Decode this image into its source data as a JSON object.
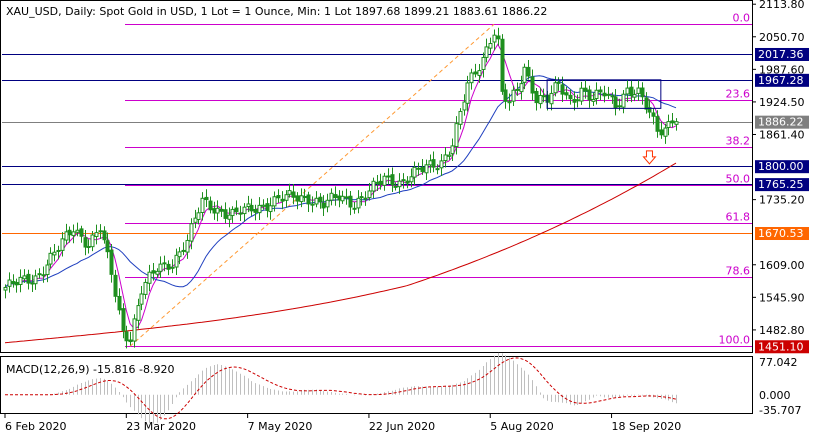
{
  "chart_data": {
    "type": "candlestick",
    "instrument": {
      "header": "XAU_USD, Daily:  Spot Gold in USD, 1 Lot = 1 Ounce, Min: 1 Lot  1897.68 1899.21 1883.61 1886.22"
    },
    "price_axis": {
      "ticks": [
        "2113.80",
        "2050.70",
        "1987.60",
        "1924.50",
        "1861.40",
        "1735.20",
        "1609.00",
        "1545.90",
        "1482.80"
      ],
      "ylim": [
        1440,
        2120
      ]
    },
    "date_axis": {
      "ticks": [
        "6 Feb 2020",
        "23 Mar 2020",
        "7 May 2020",
        "22 Jun 2020",
        "5 Aug 2020",
        "18 Sep 2020"
      ]
    },
    "horizontal_levels": [
      {
        "value": 2017.36,
        "label": "2017.36",
        "line_color": "#000080",
        "label_bg": "#000080",
        "label_fg": "#ffffff"
      },
      {
        "value": 1967.28,
        "label": "1967.28",
        "line_color": "#000080",
        "label_bg": "#000080",
        "label_fg": "#ffffff"
      },
      {
        "value": 1886.22,
        "label": "1886.22",
        "line_color": "#7f7f7f",
        "label_bg": "#7f7f7f",
        "label_fg": "#ffffff"
      },
      {
        "value": 1800.0,
        "label": "1800.00",
        "line_color": "#000080",
        "label_bg": "#000080",
        "label_fg": "#ffffff"
      },
      {
        "value": 1765.25,
        "label": "1765.25",
        "line_color": "#000080",
        "label_bg": "#000080",
        "label_fg": "#ffffff"
      },
      {
        "value": 1670.53,
        "label": "1670.53",
        "line_color": "#ff6600",
        "label_bg": "#ff6600",
        "label_fg": "#ffffff"
      },
      {
        "value": 1451.1,
        "label": "1451.10",
        "line_color": "#000000",
        "label_bg": "#cc0000",
        "label_fg": "#ffffff"
      }
    ],
    "fibonacci": {
      "color": "#cc00cc",
      "high": 2075,
      "low": 1451.1,
      "levels": [
        {
          "label": "0.0",
          "value": 2075.0
        },
        {
          "label": "23.6",
          "value": 1927.8
        },
        {
          "label": "38.2",
          "value": 1836.7
        },
        {
          "label": "50.0",
          "value": 1763.0
        },
        {
          "label": "61.8",
          "value": 1689.4
        },
        {
          "label": "78.6",
          "value": 1584.5
        },
        {
          "label": "100.0",
          "value": 1451.1
        }
      ]
    },
    "rectangle_zone": {
      "color": "#000080",
      "price_top": 1967.28,
      "price_bottom": 1912.0,
      "from_day": 143,
      "to_day": 173
    },
    "down_arrow": {
      "color": "#ff3300",
      "price": 1818,
      "day": 170
    },
    "moving_averages": [
      {
        "color": "#cc00cc",
        "period_note": "fast"
      },
      {
        "color": "#1f3fbf",
        "period_note": "medium"
      },
      {
        "color": "#cc0000",
        "period_note": "slow"
      }
    ],
    "macd": {
      "label": "MACD(12,26,9) -15.816 -8.920",
      "ticks": [
        "77.042",
        "0.000",
        "-35.707"
      ],
      "ylim": [
        -35.707,
        77.042
      ],
      "histogram_color": "#bfbfbf",
      "signal_color": "#cc0000"
    },
    "colors": {
      "bull_candle": "#1f8f1f",
      "bear_candle": "#1f8f1f",
      "background": "#ffffff",
      "axis": "#000000"
    },
    "series_days": {
      "start_label": "6 Feb 2020",
      "bars": 178
    },
    "anchors": [
      [
        0,
        1565
      ],
      [
        8,
        1585
      ],
      [
        14,
        1640
      ],
      [
        18,
        1680
      ],
      [
        22,
        1650
      ],
      [
        25,
        1680
      ],
      [
        28,
        1590
      ],
      [
        31,
        1480
      ],
      [
        33,
        1470
      ],
      [
        36,
        1560
      ],
      [
        40,
        1600
      ],
      [
        44,
        1615
      ],
      [
        48,
        1655
      ],
      [
        50,
        1695
      ],
      [
        52,
        1730
      ],
      [
        55,
        1720
      ],
      [
        60,
        1705
      ],
      [
        66,
        1720
      ],
      [
        72,
        1735
      ],
      [
        76,
        1740
      ],
      [
        80,
        1740
      ],
      [
        84,
        1725
      ],
      [
        88,
        1740
      ],
      [
        92,
        1730
      ],
      [
        96,
        1750
      ],
      [
        100,
        1775
      ],
      [
        104,
        1770
      ],
      [
        108,
        1785
      ],
      [
        112,
        1800
      ],
      [
        115,
        1810
      ],
      [
        118,
        1845
      ],
      [
        120,
        1900
      ],
      [
        122,
        1955
      ],
      [
        124,
        1980
      ],
      [
        126,
        2010
      ],
      [
        128,
        2050
      ],
      [
        129,
        2063
      ],
      [
        130,
        2040
      ],
      [
        131,
        1940
      ],
      [
        133,
        1920
      ],
      [
        135,
        1945
      ],
      [
        137,
        1990
      ],
      [
        140,
        1935
      ],
      [
        143,
        1930
      ],
      [
        146,
        1955
      ],
      [
        149,
        1925
      ],
      [
        152,
        1950
      ],
      [
        155,
        1930
      ],
      [
        158,
        1940
      ],
      [
        161,
        1920
      ],
      [
        164,
        1950
      ],
      [
        167,
        1940
      ],
      [
        170,
        1900
      ],
      [
        172,
        1870
      ],
      [
        174,
        1875
      ],
      [
        176,
        1895
      ],
      [
        177,
        1886
      ]
    ]
  }
}
